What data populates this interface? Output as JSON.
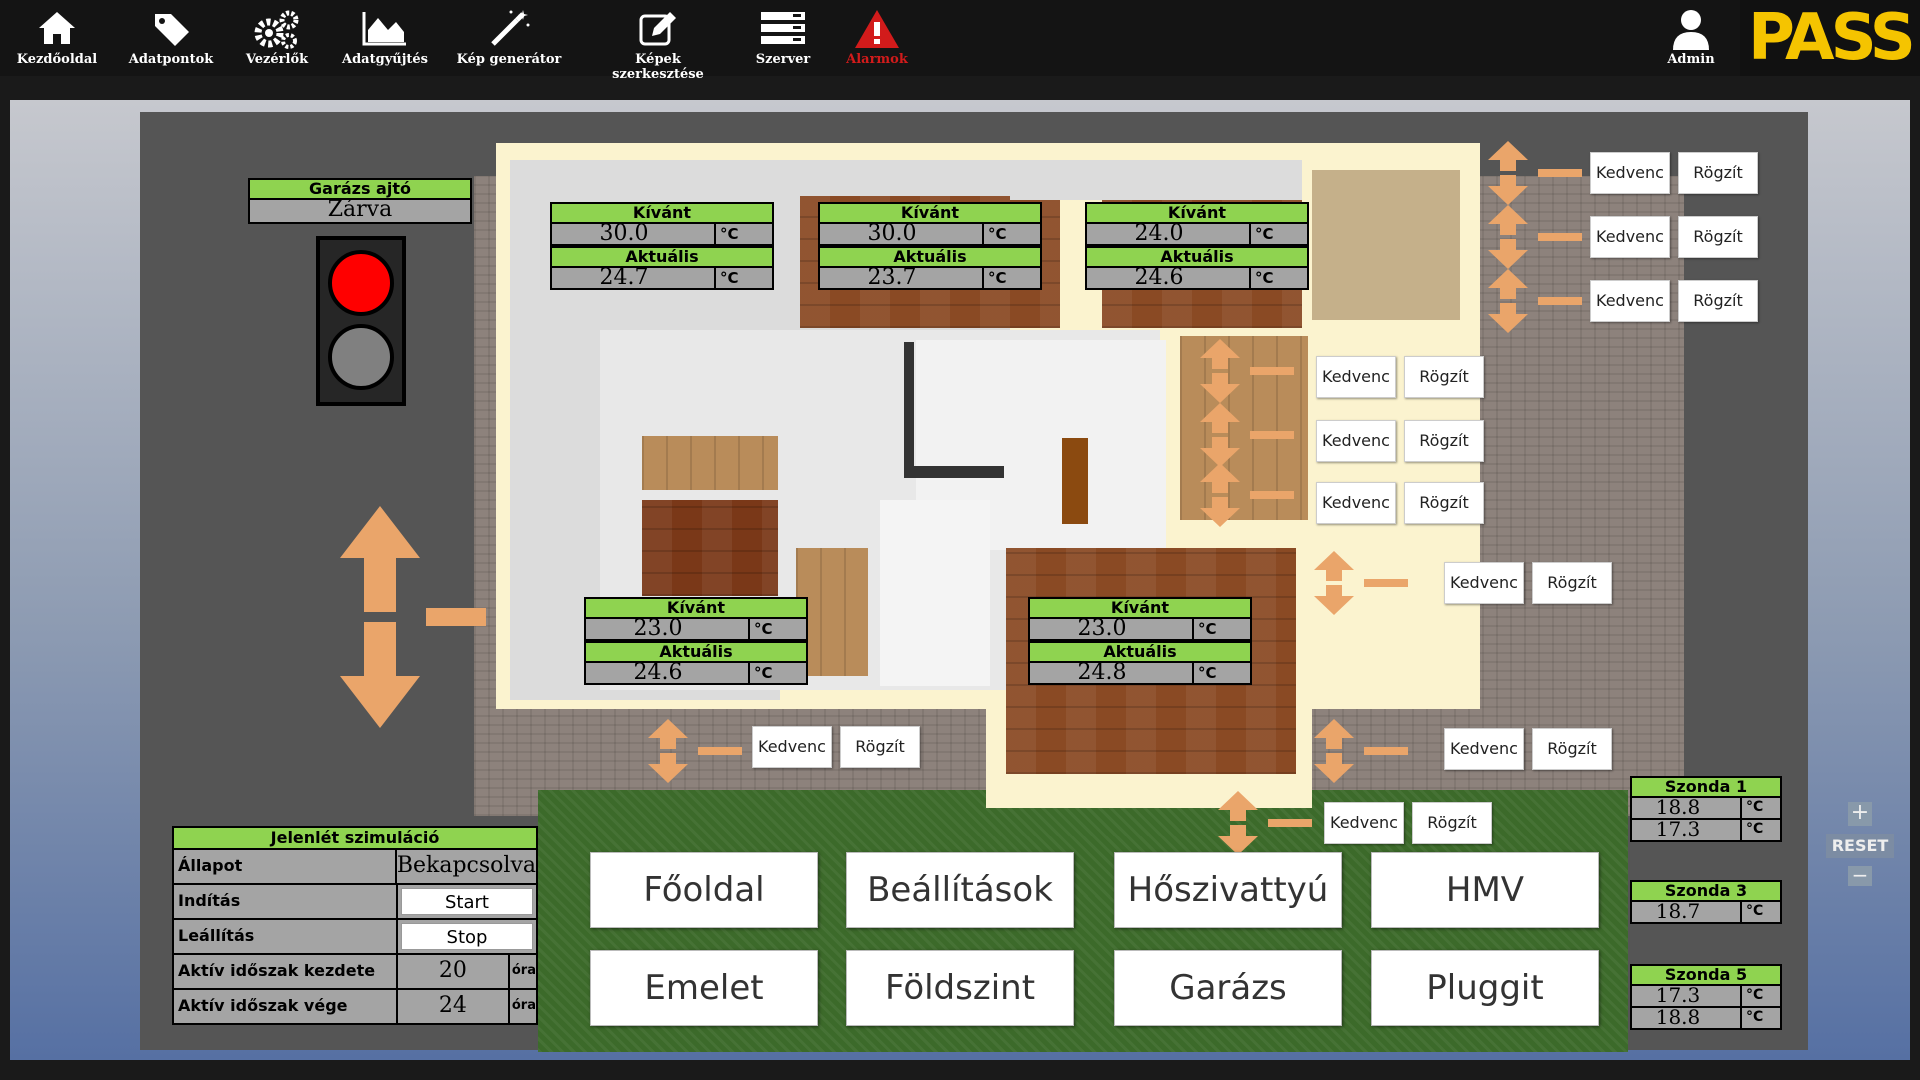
{
  "nav": [
    {
      "label": "Kezdőoldal",
      "icon": "home-icon"
    },
    {
      "label": "Adatpontok",
      "icon": "tag-icon"
    },
    {
      "label": "Vezérlők",
      "icon": "gears-icon"
    },
    {
      "label": "Adatgyűjtés",
      "icon": "area-chart-icon"
    },
    {
      "label": "Kép generátor",
      "icon": "magic-wand-icon"
    },
    {
      "label": "Képek szerkesztése",
      "icon": "edit-icon"
    },
    {
      "label": "Szerver",
      "icon": "server-icon"
    },
    {
      "label": "Alarmok",
      "icon": "warning-icon"
    }
  ],
  "user": {
    "label": "Admin",
    "icon": "user-icon"
  },
  "logo": "PASS",
  "garage": {
    "title": "Garázs ajtó",
    "state": "Zárva",
    "light_red": "#ff0000",
    "light_off": "#808080"
  },
  "rooms": [
    {
      "target_label": "Kívánt",
      "target": "30.0",
      "actual_label": "Aktuális",
      "actual": "24.7",
      "unit": "°C"
    },
    {
      "target_label": "Kívánt",
      "target": "30.0",
      "actual_label": "Aktuális",
      "actual": "23.7",
      "unit": "°C"
    },
    {
      "target_label": "Kívánt",
      "target": "24.0",
      "actual_label": "Aktuális",
      "actual": "24.6",
      "unit": "°C"
    },
    {
      "target_label": "Kívánt",
      "target": "23.0",
      "actual_label": "Aktuális",
      "actual": "24.6",
      "unit": "°C"
    },
    {
      "target_label": "Kívánt",
      "target": "23.0",
      "actual_label": "Aktuális",
      "actual": "24.8",
      "unit": "°C"
    }
  ],
  "blind_buttons": {
    "favorite": "Kedvenc",
    "save": "Rögzít"
  },
  "simulation": {
    "title": "Jelenlét szimuláció",
    "state_label": "Állapot",
    "state": "Bekapcsolva",
    "start_label": "Indítás",
    "start_btn": "Start",
    "stop_label": "Leállítás",
    "stop_btn": "Stop",
    "from_label": "Aktív időszak kezdete",
    "from": "20",
    "to_label": "Aktív időszak vége",
    "to": "24",
    "hour_unit": "óra"
  },
  "main_buttons": [
    "Főoldal",
    "Beállítások",
    "Hőszivattyú",
    "HMV",
    "Emelet",
    "Földszint",
    "Garázs",
    "Pluggit"
  ],
  "zones": [
    {
      "title": "Szonda 1",
      "values": [
        "18.8",
        "17.3"
      ],
      "unit": "°C"
    },
    {
      "title": "Szonda 3",
      "values": [
        "18.7"
      ],
      "unit": "°C"
    },
    {
      "title": "Szonda 5",
      "values": [
        "17.3",
        "18.8"
      ],
      "unit": "°C"
    }
  ],
  "zoom": {
    "plus": "+",
    "reset": "RESET",
    "minus": "−"
  },
  "colors": {
    "accent_green": "#8fd350",
    "arrow": "#eaa56a",
    "alarm": "#d21b1b",
    "logo": "#f5c400"
  }
}
